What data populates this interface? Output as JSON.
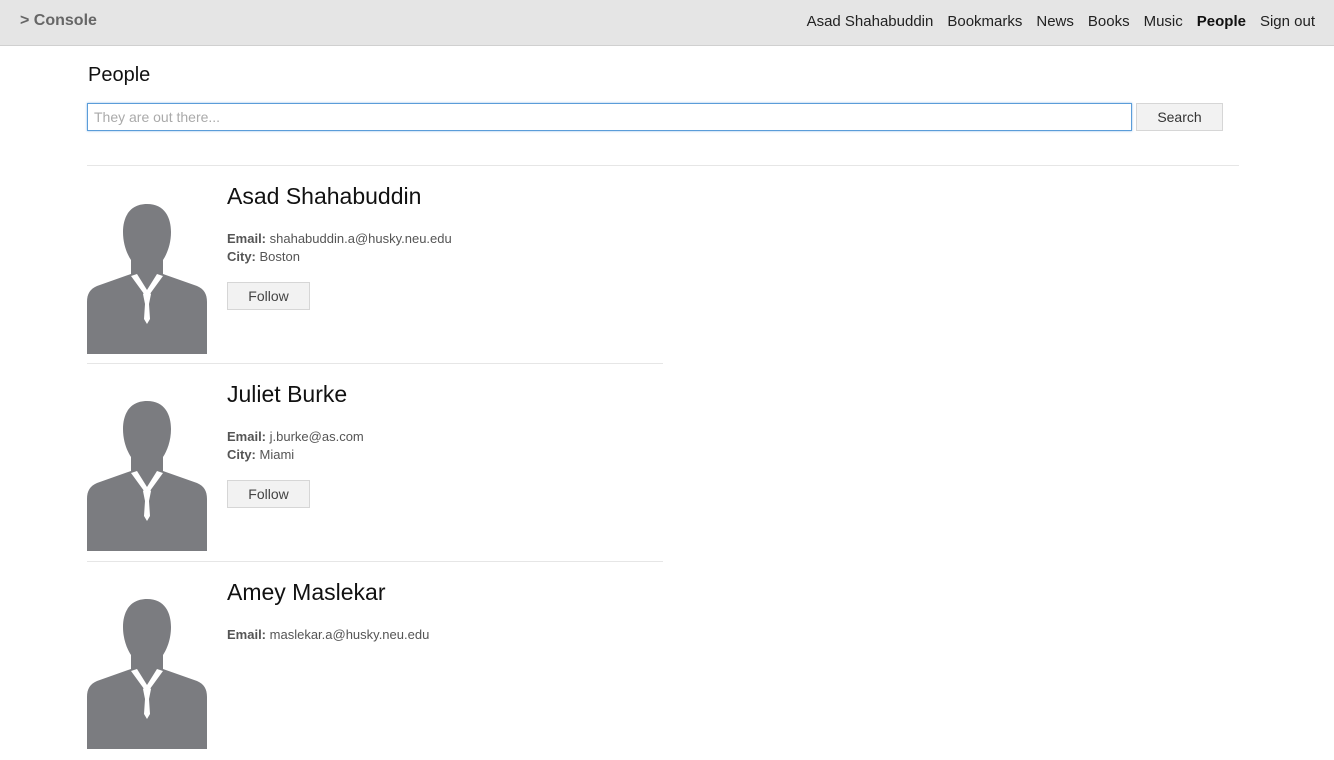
{
  "navbar": {
    "brand": "> Console",
    "links": [
      {
        "label": "Asad Shahabuddin",
        "active": false
      },
      {
        "label": "Bookmarks",
        "active": false
      },
      {
        "label": "News",
        "active": false
      },
      {
        "label": "Books",
        "active": false
      },
      {
        "label": "Music",
        "active": false
      },
      {
        "label": "People",
        "active": true
      },
      {
        "label": "Sign out",
        "active": false
      }
    ]
  },
  "page": {
    "title": "People"
  },
  "search": {
    "placeholder": "They are out there...",
    "value": "",
    "button_label": "Search"
  },
  "labels": {
    "email": "Email:",
    "city": "City:",
    "follow": "Follow"
  },
  "people": [
    {
      "name": "Asad Shahabuddin",
      "email": "shahabuddin.a@husky.neu.edu",
      "city": "Boston"
    },
    {
      "name": "Juliet Burke",
      "email": "j.burke@as.com",
      "city": "Miami"
    },
    {
      "name": "Amey Maslekar",
      "email": "maslekar.a@husky.neu.edu",
      "city": ""
    }
  ],
  "colors": {
    "navbar_bg": "#e5e5e5",
    "avatar": "#7b7c80",
    "focus_border": "#5b9dd9"
  },
  "icons": {
    "avatar": "person-silhouette-icon"
  }
}
